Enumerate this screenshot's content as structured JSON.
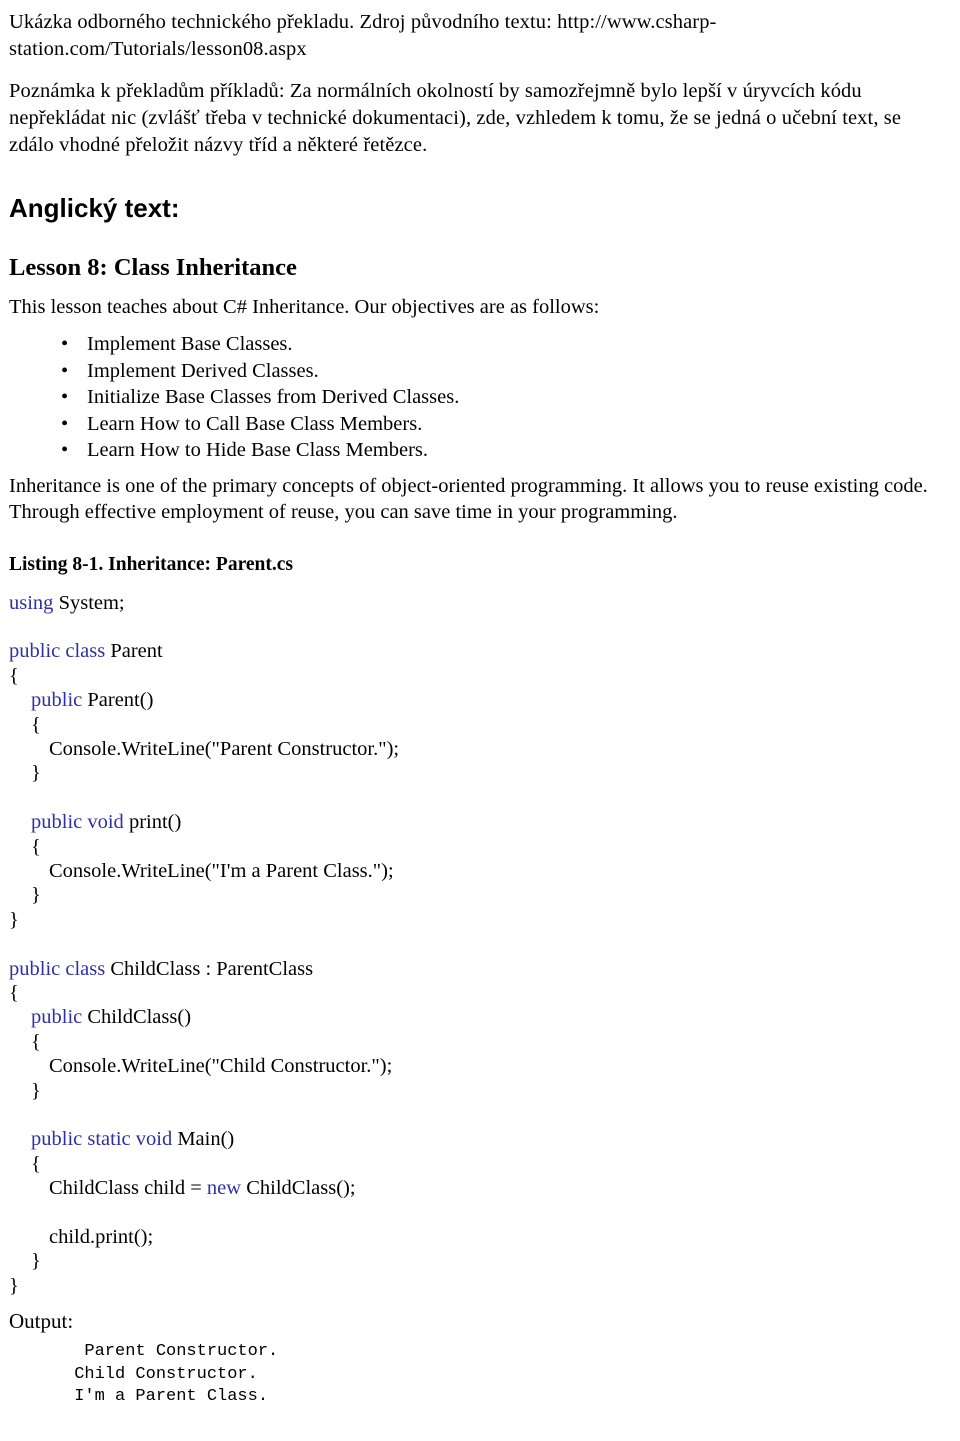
{
  "document": {
    "source_note": "Ukázka odborného technického překladu. Zdroj původního textu: http://www.csharp-station.com/Tutorials/lesson08.aspx",
    "translator_note": "Poznámka k překladům příkladů: Za normálních okolností by samozřejmně bylo lepší v úryvcích kódu nepřekládat nic (zvlášť třeba v technické dokumentaci), zde, vzhledem k tomu, že se jedná o učební text, se zdálo vhodné přeložit názvy tříd a některé řetězce.",
    "section_heading": "Anglický text:",
    "lesson_title": "Lesson 8: Class Inheritance",
    "intro_line": "This lesson teaches about C# Inheritance. Our objectives are as follows:",
    "bullet_glyph": "•",
    "objectives": [
      "Implement Base Classes.",
      "Implement Derived Classes.",
      "Initialize Base Classes from Derived Classes.",
      "Learn How to Call Base Class Members.",
      "Learn How to Hide Base Class Members."
    ],
    "body_paragraph": "Inheritance is one of the primary concepts of object-oriented programming. It allows you to reuse existing code. Through effective employment of reuse, you can save time in your programming.",
    "listing_caption": "Listing 8-1. Inheritance: Parent.cs",
    "output_label": "Output:",
    "keyword_color": "#2F2FA8",
    "text_color": "#000000",
    "background_color": "#FFFFFF"
  },
  "code": {
    "lines": [
      {
        "indent": 0,
        "keyword": "using",
        "rest": " System;"
      },
      {
        "indent": 0,
        "keyword": "",
        "rest": ""
      },
      {
        "indent": 0,
        "keyword": "public class",
        "rest": " Parent"
      },
      {
        "indent": 0,
        "keyword": "",
        "rest": "{"
      },
      {
        "indent": 1,
        "keyword": "public",
        "rest": " Parent()"
      },
      {
        "indent": 1,
        "keyword": "",
        "rest": "{"
      },
      {
        "indent": 2,
        "keyword": "",
        "rest": "Console.WriteLine(\"Parent Constructor.\");"
      },
      {
        "indent": 1,
        "keyword": "",
        "rest": "}"
      },
      {
        "indent": 0,
        "keyword": "",
        "rest": ""
      },
      {
        "indent": 1,
        "keyword": "public void",
        "rest": " print()"
      },
      {
        "indent": 1,
        "keyword": "",
        "rest": "{"
      },
      {
        "indent": 2,
        "keyword": "",
        "rest": "Console.WriteLine(\"I'm a Parent Class.\");"
      },
      {
        "indent": 1,
        "keyword": "",
        "rest": "}"
      },
      {
        "indent": 0,
        "keyword": "",
        "rest": "}"
      },
      {
        "indent": 0,
        "keyword": "",
        "rest": ""
      },
      {
        "indent": 0,
        "keyword": "public class",
        "rest": " ChildClass : ParentClass"
      },
      {
        "indent": 0,
        "keyword": "",
        "rest": "{"
      },
      {
        "indent": 1,
        "keyword": "public",
        "rest": " ChildClass()"
      },
      {
        "indent": 1,
        "keyword": "",
        "rest": "{"
      },
      {
        "indent": 2,
        "keyword": "",
        "rest": "Console.WriteLine(\"Child Constructor.\");"
      },
      {
        "indent": 1,
        "keyword": "",
        "rest": "}"
      },
      {
        "indent": 0,
        "keyword": "",
        "rest": ""
      },
      {
        "indent": 1,
        "keyword": "public static void",
        "rest": " Main()"
      },
      {
        "indent": 1,
        "keyword": "",
        "rest": "{"
      },
      {
        "indent": 2,
        "keyword": "",
        "rest": "ChildClass child = ",
        "keyword2": "new",
        "rest2": " ChildClass();"
      },
      {
        "indent": 0,
        "keyword": "",
        "rest": ""
      },
      {
        "indent": 2,
        "keyword": "",
        "rest": "child.print();"
      },
      {
        "indent": 1,
        "keyword": "",
        "rest": "}"
      },
      {
        "indent": 0,
        "keyword": "",
        "rest": "}"
      }
    ]
  },
  "console_output": {
    "lines": [
      "  Parent Constructor.",
      " Child Constructor.",
      " I'm a Parent Class."
    ]
  }
}
